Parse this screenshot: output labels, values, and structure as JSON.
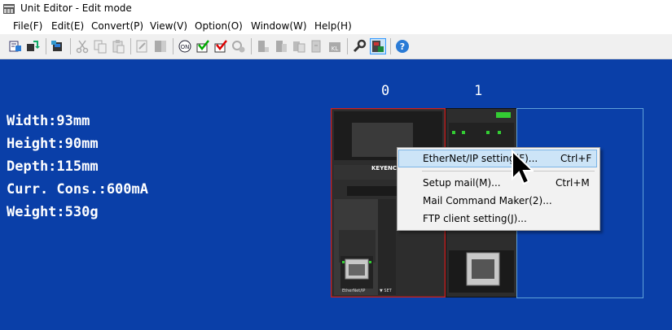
{
  "window": {
    "title": "Unit Editor - Edit mode"
  },
  "menu": [
    "File(F)",
    "Edit(E)",
    "Convert(P)",
    "View(V)",
    "Option(O)",
    "Window(W)",
    "Help(H)"
  ],
  "toolbar_icons": [
    "new-unit-icon",
    "open-icon",
    "transfer-icon",
    "cut-icon",
    "copy-icon",
    "paste-icon",
    "edit-icon",
    "delete-icon",
    "monitor-icon",
    "check-icon",
    "verify-icon",
    "disconnect-icon",
    "read-icon",
    "write-icon",
    "compare-icon",
    "download-icon",
    "kl-icon",
    "wrench-icon",
    "unit-setting-icon",
    "help-icon"
  ],
  "slots": [
    "0",
    "1"
  ],
  "specs": [
    "Width:93mm",
    "Height:90mm",
    "Depth:115mm",
    "Curr. Cons.:600mA",
    "Weight:530g"
  ],
  "unit0": {
    "brand": "KEYENCE",
    "port_label": "EtherNet/IP",
    "arrow_label": "▼ SET"
  },
  "context_menu": [
    {
      "label": "EtherNet/IP setting(F)...",
      "shortcut": "Ctrl+F",
      "highlighted": true
    },
    {
      "label": "Setup mail(M)...",
      "shortcut": "Ctrl+M",
      "highlighted": false
    },
    {
      "label": "Mail Command Maker(2)...",
      "shortcut": "",
      "highlighted": false
    },
    {
      "label": "FTP client setting(J)...",
      "shortcut": "",
      "highlighted": false
    }
  ],
  "colors": {
    "canvas": "#0a3fa8",
    "highlight": "#cce4f7",
    "selection_border": "#d02020"
  }
}
